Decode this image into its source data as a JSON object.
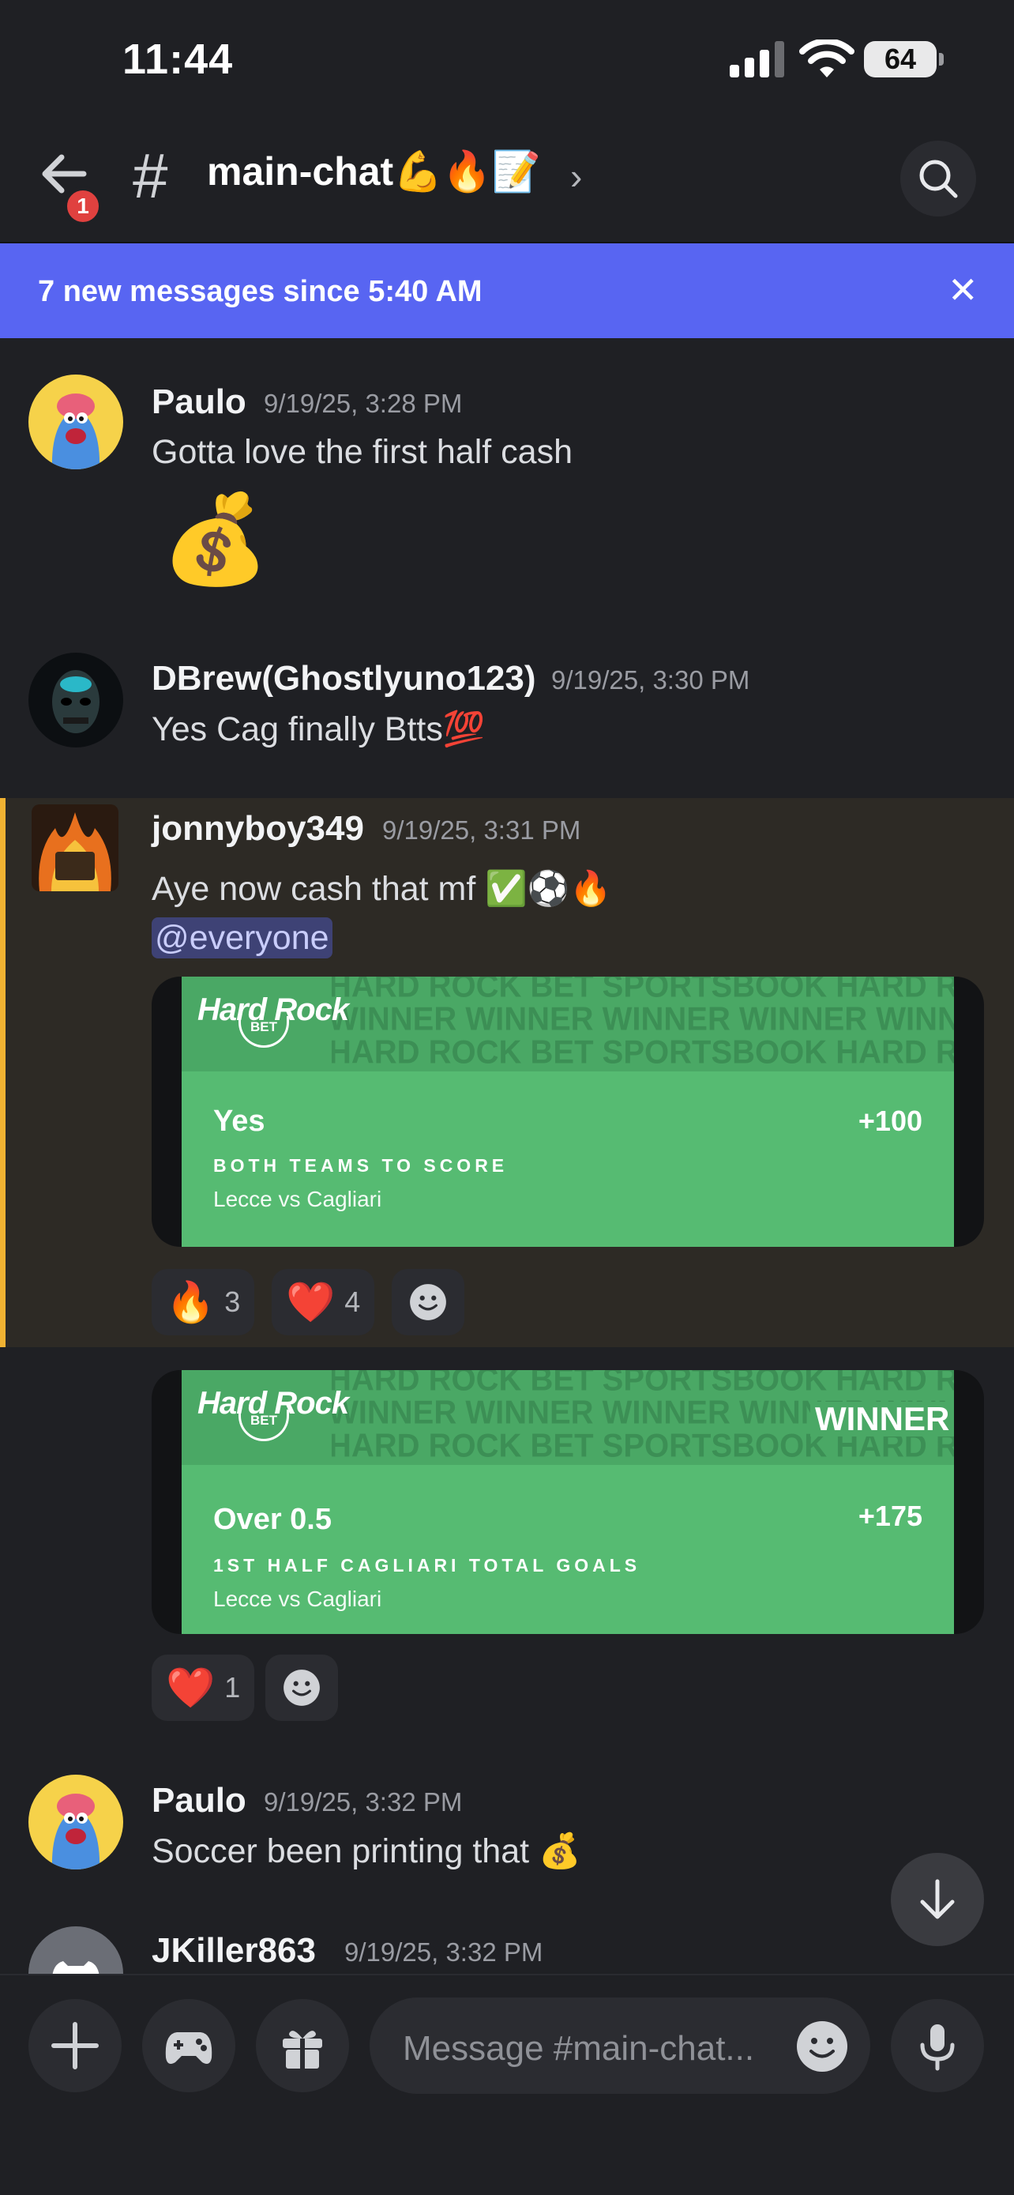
{
  "status_bar": {
    "time": "11:44",
    "battery": "64"
  },
  "header": {
    "back_badge": "1",
    "channel": "main-chat💪🔥📝",
    "chevron": "›"
  },
  "banner": {
    "text": "7 new messages since 5:40 AM",
    "close": "✕"
  },
  "messages": [
    {
      "author": "Paulo",
      "timestamp": "9/19/25, 3:28 PM",
      "text": "Gotta love the first half cash",
      "sticker": "💰"
    },
    {
      "author": "DBrew(Ghostlyuno123)",
      "timestamp": "9/19/25, 3:30 PM",
      "text": "Yes Cag finally Btts💯"
    },
    {
      "author": "jonnyboy349",
      "timestamp": "9/19/25, 3:31 PM",
      "text": "Aye now cash that mf ✅⚽🔥",
      "mention": "@everyone",
      "bet_card": {
        "logo_top": "Hard Rock",
        "logo_bottom": "BET",
        "pattern_1": "HARD ROCK BET SPORTSBOOK HARD ROCK BET SPORTSBOOK",
        "pattern_2": "WINNER WINNER WINNER WINNER WINNER WINNER WINNER",
        "pattern_3": "HARD ROCK BET SPORTSBOOK HARD ROCK BET SPORTSBOOK",
        "selection": "Yes",
        "odds": "+100",
        "market": "BOTH TEAMS TO SCORE",
        "match": "Lecce vs Cagliari"
      },
      "reactions": [
        {
          "emoji": "🔥",
          "count": "3"
        },
        {
          "emoji": "❤️",
          "count": "4"
        }
      ]
    },
    {
      "bet_card": {
        "logo_top": "Hard Rock",
        "logo_bottom": "BET",
        "pattern_1": "HARD ROCK BET SPORTSBOOK HARD ROCK BET SPORTSBOOK",
        "pattern_2": "WINNER WINNER WINNER WINNER WINNER WINNER WINNER",
        "pattern_3": "HARD ROCK BET SPORTSBOOK HARD ROCK BET SPORTSBOOK",
        "winner": "WINNER",
        "selection": "Over 0.5",
        "odds": "+175",
        "market": "1ST HALF CAGLIARI TOTAL GOALS",
        "match": "Lecce vs Cagliari"
      },
      "reactions": [
        {
          "emoji": "❤️",
          "count": "1"
        }
      ]
    },
    {
      "author": "Paulo",
      "timestamp": "9/19/25, 3:32 PM",
      "text": "Soccer been printing that 💰"
    },
    {
      "author": "JKiller863",
      "timestamp": "9/19/25, 3:32 PM"
    }
  ],
  "composer": {
    "placeholder": "Message #main-chat..."
  },
  "colors": {
    "accent": "#5865f2",
    "highlight_bar": "#f0b232",
    "bet_green": "#56bb72",
    "mention_bg": "#3e4275",
    "badge": "#e0413f"
  }
}
